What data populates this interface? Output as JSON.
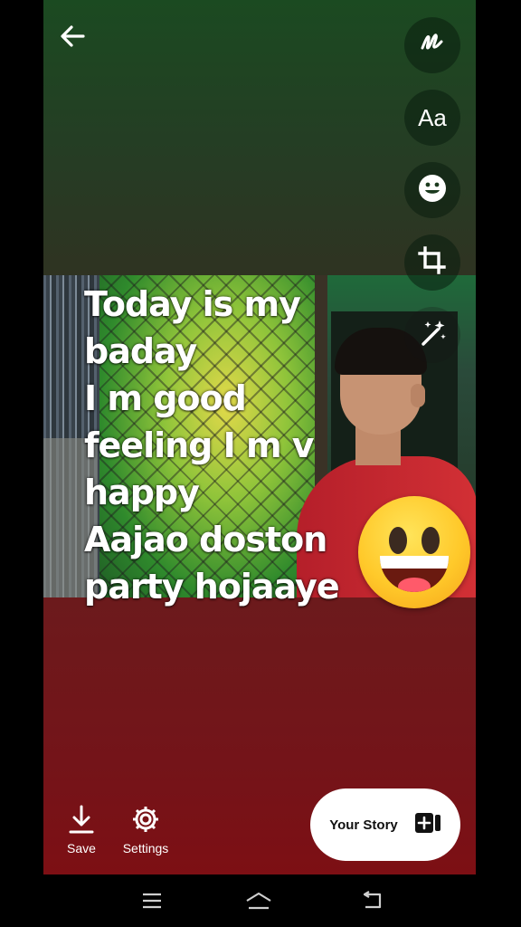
{
  "story": {
    "text_lines": "Today is my\nbaday\nI m good\nfeeling I m v\nhappy\nAajao doston\nparty hojaaye"
  },
  "toolbar": {
    "text_tool_label": "Aa"
  },
  "bottom_actions": {
    "save_label": "Save",
    "settings_label": "Settings"
  },
  "share": {
    "your_story_label": "Your Story"
  },
  "colors": {
    "top_background": "#1b4a21",
    "bottom_background": "#7a1114",
    "shirt": "#c8262e"
  },
  "icons": [
    "back-arrow-icon",
    "squiggle-draw-icon",
    "text-icon",
    "sticker-icon",
    "crop-icon",
    "magic-wand-icon",
    "download-icon",
    "gear-icon",
    "add-to-story-icon",
    "menu-icon",
    "home-icon",
    "back-icon"
  ]
}
